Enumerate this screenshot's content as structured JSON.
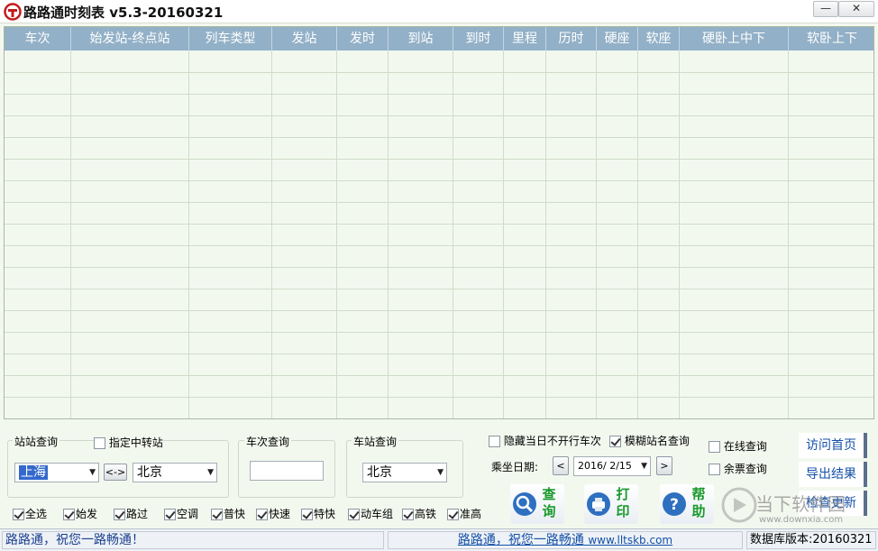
{
  "app": {
    "title": "路路通时刻表 v5.3-20160321"
  },
  "window_controls": {
    "minimize": "—",
    "close": "✕"
  },
  "table": {
    "columns": [
      "车次",
      "始发站-终点站",
      "列车类型",
      "发站",
      "发时",
      "到站",
      "到时",
      "里程",
      "历时",
      "硬座",
      "软座",
      "硬卧上中下",
      "软卧上下"
    ]
  },
  "station_query": {
    "title": "站站查询",
    "transfer_label": "指定中转站",
    "from": "上海",
    "swap_label": "<->",
    "to": "北京"
  },
  "train_query": {
    "title": "车次查询",
    "value": ""
  },
  "station_only": {
    "title": "车站查询",
    "value": "北京"
  },
  "options": {
    "hide_not_running": "隐藏当日不开行车次",
    "fuzzy_name": "模糊站名查询",
    "online_query": "在线查询",
    "remaining_tickets": "余票查询"
  },
  "date": {
    "label": "乘坐日期:",
    "value": "2016/ 2/15",
    "prev": "<",
    "next": ">"
  },
  "actions": {
    "query_label": "查询",
    "print_label": "打印",
    "help_label": "帮助"
  },
  "side_buttons": {
    "visit_home": "访问首页",
    "export": "导出结果",
    "check_update": "检查更新"
  },
  "filters": [
    "全选",
    "始发",
    "路过",
    "空调",
    "普快",
    "快速",
    "特快",
    "动车组",
    "高铁",
    "准高"
  ],
  "status": {
    "left": "路路通，祝您一路畅通！",
    "center_text": "路路通，祝您一路畅通",
    "center_url": "www.lltskb.com",
    "right": "数据库版本:20160321"
  },
  "watermark": {
    "text": "当下软件园",
    "url": "www.downxia.com"
  }
}
